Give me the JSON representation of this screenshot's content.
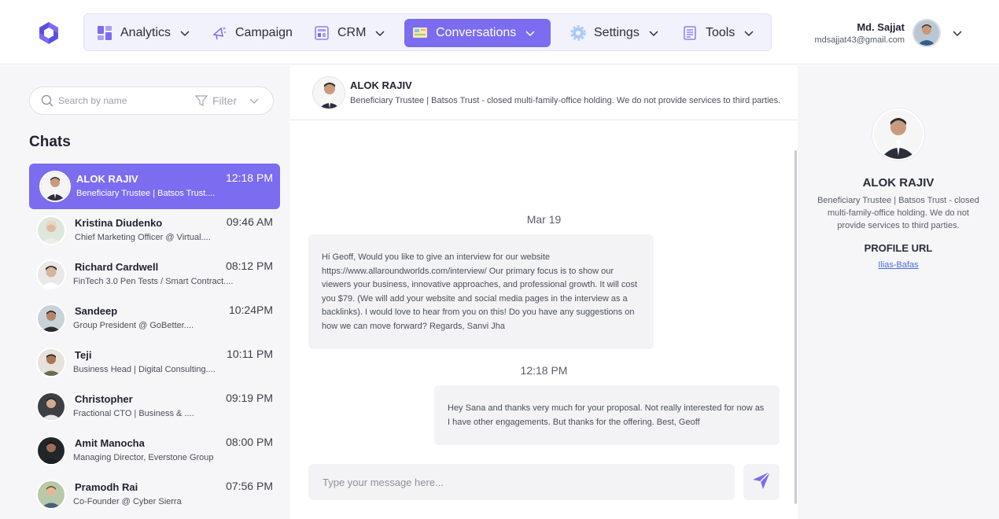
{
  "brand": {
    "accent": "#7b6cf0",
    "logo_icon": "brand-logo-icon"
  },
  "nav": {
    "items": [
      {
        "label": "Analytics",
        "icon": "analytics-icon",
        "has_dropdown": true
      },
      {
        "label": "Campaign",
        "icon": "campaign-icon",
        "has_dropdown": false
      },
      {
        "label": "CRM",
        "icon": "crm-icon",
        "has_dropdown": true
      },
      {
        "label": "Conversations",
        "icon": "conversations-icon",
        "has_dropdown": true,
        "active": true
      },
      {
        "label": "Settings",
        "icon": "gear-icon",
        "has_dropdown": true
      },
      {
        "label": "Tools",
        "icon": "tools-icon",
        "has_dropdown": true
      }
    ]
  },
  "user": {
    "name": "Md. Sajjat",
    "email": "mdsajjat43@gmail.com"
  },
  "sidebar": {
    "search_placeholder": "Search by name",
    "filter_label": "Filter",
    "chats_title": "Chats",
    "chats": [
      {
        "name": "ALOK RAJIV",
        "subtitle": "Beneficiary Trustee | Batsos Trust....",
        "time": "12:18 PM",
        "active": true
      },
      {
        "name": "Kristina Diudenko",
        "subtitle": "Chief Marketing Officer @ Virtual....",
        "time": "09:46 AM"
      },
      {
        "name": "Richard Cardwell",
        "subtitle": "FinTech 3.0 Pen Tests / Smart Contract....",
        "time": "08:12 PM"
      },
      {
        "name": "Sandeep",
        "subtitle": "Group President @ GoBetter....",
        "time": "10:24PM"
      },
      {
        "name": "Teji",
        "subtitle": "Business Head | Digital Consulting....",
        "time": "10:11 PM"
      },
      {
        "name": "Christopher",
        "subtitle": "Fractional CTO | Business & ....",
        "time": "09:19 PM"
      },
      {
        "name": "Amit Manocha",
        "subtitle": "Managing Director, Everstone Group",
        "time": "08:00 PM"
      },
      {
        "name": "Pramodh Rai",
        "subtitle": "Co-Founder @ Cyber Sierra",
        "time": "07:56 PM"
      }
    ]
  },
  "conversation": {
    "header_name": "ALOK RAJIV",
    "header_subtitle": "Beneficiary Trustee | Batsos Trust - closed multi-family-office holding. We do not provide services to third parties.",
    "date_separator": "Mar 19",
    "incoming_message": "Hi Geoff,  Would you like to give an interview for our website https://www.allaroundworlds.com/interview/  Our primary focus is to show our viewers your business, innovative approaches, and professional growth.  It will cost you $79.  (We will add your website and social media pages in the interview as a backlinks).  I would love to hear from you on this! Do you have any suggestions on how we can move forward?  Regards, Sanvi Jha",
    "time_separator": "12:18 PM",
    "outgoing_message": "Hey Sana and thanks very much for your proposal. Not really interested for now as I have other engagements. But thanks for the offering. Best, Geoff",
    "composer_placeholder": "Type your message here...",
    "send_icon": "send-icon"
  },
  "profile": {
    "name": "ALOK RAJIV",
    "bio": "Beneficiary Trustee | Batsos Trust - closed multi-family-office holding. We do not provide services to third parties.",
    "url_title": "PROFILE URL",
    "url_text": "Ilias-Bafas"
  }
}
